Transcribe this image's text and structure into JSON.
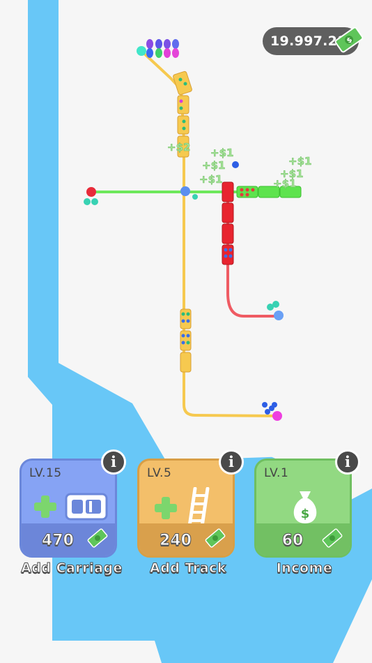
{
  "hud": {
    "balance": "19.997.28",
    "bill_icon": "cash-bill-icon"
  },
  "floating_income": [
    "+$2",
    "+$1",
    "+$1",
    "+$1",
    "+$1",
    "+$1",
    "+$1"
  ],
  "upgrades": [
    {
      "id": "add-carriage",
      "level": "LV.15",
      "cost": "470",
      "label": "Add Carriage",
      "icon": "carriage-icon",
      "color": "#7f9cf0"
    },
    {
      "id": "add-track",
      "level": "LV.5",
      "cost": "240",
      "label": "Add Track",
      "icon": "ladder-track-icon",
      "color": "#f1b95f"
    },
    {
      "id": "income",
      "level": "LV.1",
      "cost": "60",
      "label": "Income",
      "icon": "money-bag-icon",
      "color": "#8bd77c"
    }
  ],
  "info_label": "i",
  "colors": {
    "water": "#68c7f7",
    "land": "#f6f6f6",
    "track_yellow": "#f6c94f",
    "track_green": "#6de85b",
    "track_red": "#ef5b63"
  }
}
